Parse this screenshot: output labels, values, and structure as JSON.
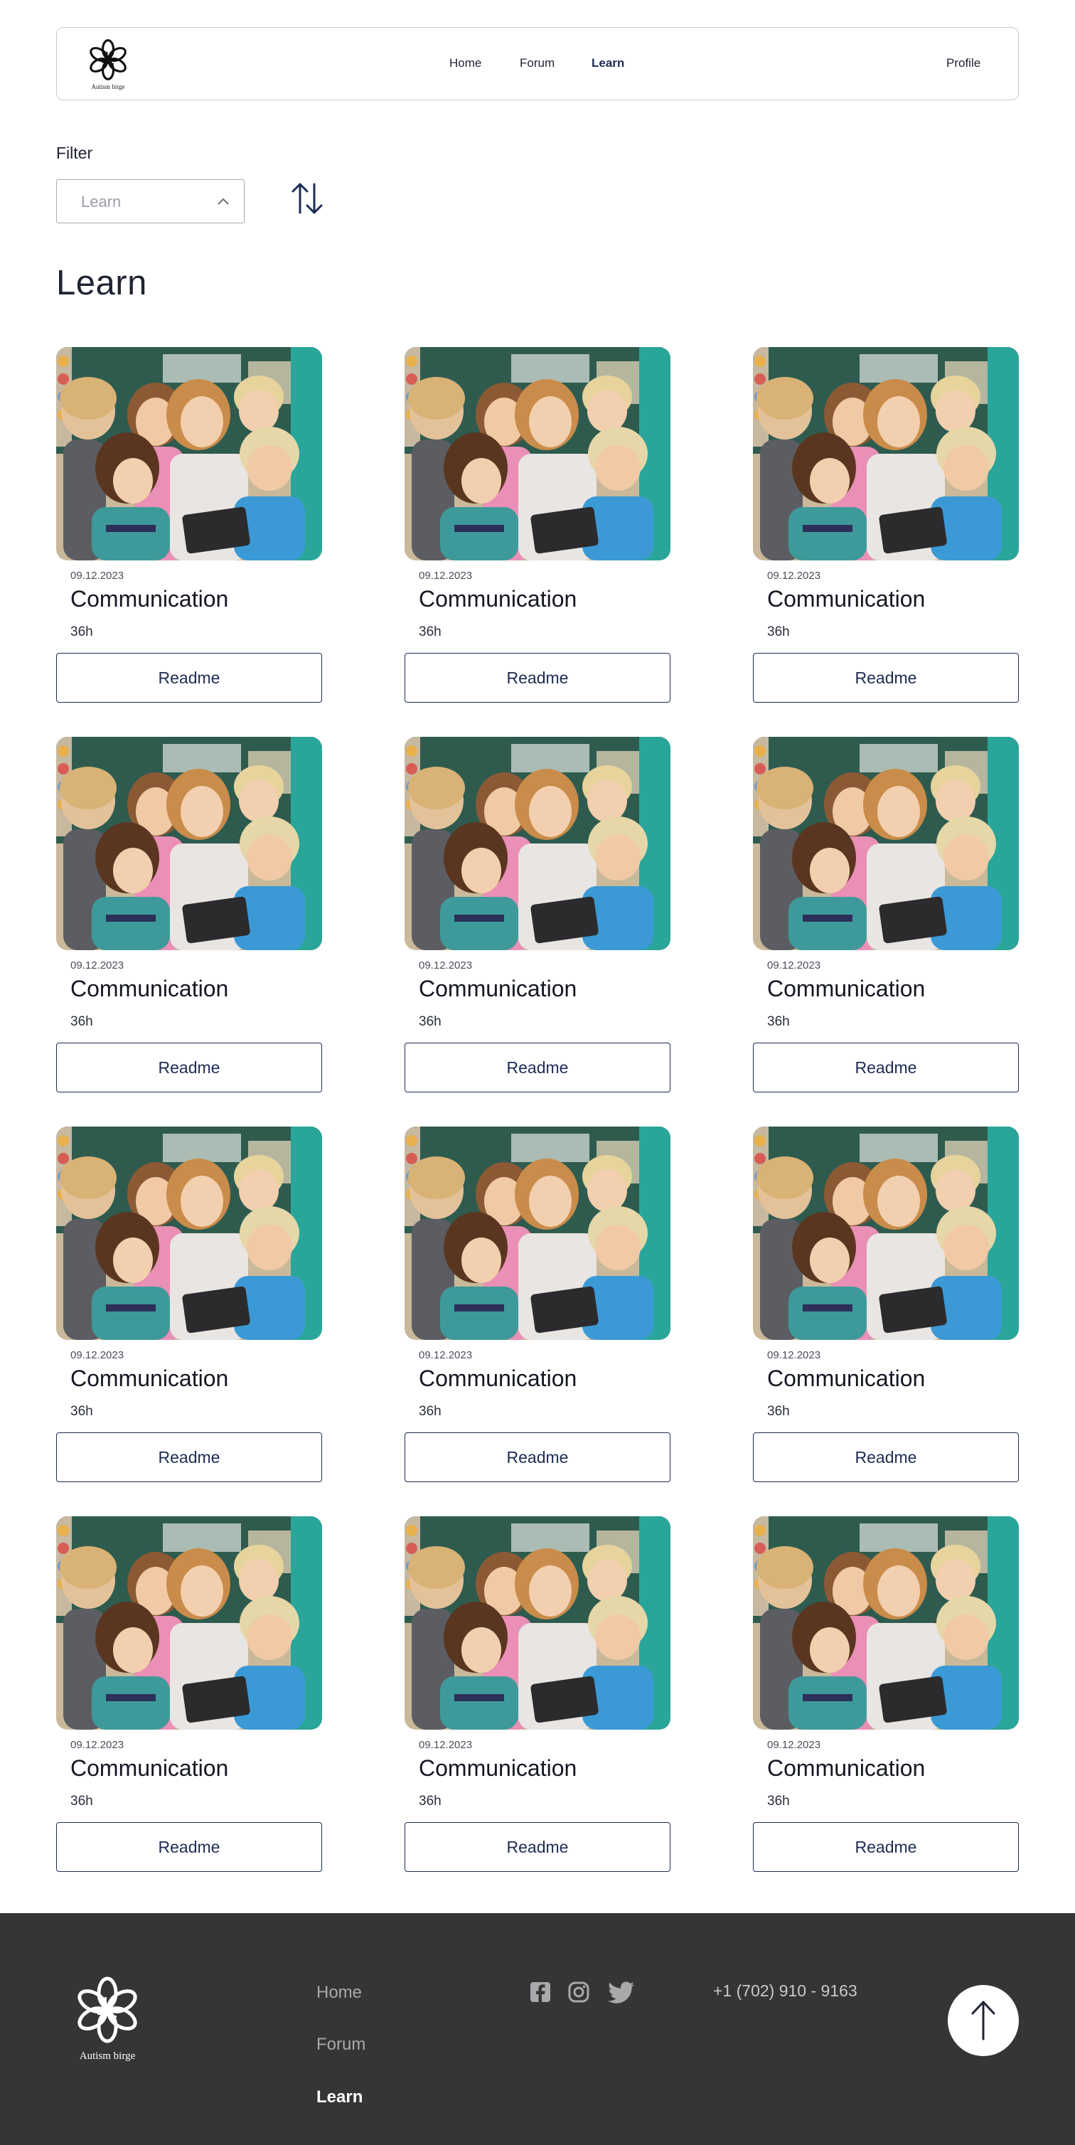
{
  "header": {
    "logo_text": "Autism birge",
    "nav": [
      {
        "label": "Home",
        "active": false
      },
      {
        "label": "Forum",
        "active": false
      },
      {
        "label": "Learn",
        "active": true
      }
    ],
    "profile_label": "Profile"
  },
  "filter": {
    "label": "Filter",
    "selected": "Learn"
  },
  "page_title": "Learn",
  "cards": [
    {
      "date": "09.12.2023",
      "title": "Communication",
      "duration": "36h",
      "button": "Readme"
    },
    {
      "date": "09.12.2023",
      "title": "Communication",
      "duration": "36h",
      "button": "Readme"
    },
    {
      "date": "09.12.2023",
      "title": "Communication",
      "duration": "36h",
      "button": "Readme"
    },
    {
      "date": "09.12.2023",
      "title": "Communication",
      "duration": "36h",
      "button": "Readme"
    },
    {
      "date": "09.12.2023",
      "title": "Communication",
      "duration": "36h",
      "button": "Readme"
    },
    {
      "date": "09.12.2023",
      "title": "Communication",
      "duration": "36h",
      "button": "Readme"
    },
    {
      "date": "09.12.2023",
      "title": "Communication",
      "duration": "36h",
      "button": "Readme"
    },
    {
      "date": "09.12.2023",
      "title": "Communication",
      "duration": "36h",
      "button": "Readme"
    },
    {
      "date": "09.12.2023",
      "title": "Communication",
      "duration": "36h",
      "button": "Readme"
    },
    {
      "date": "09.12.2023",
      "title": "Communication",
      "duration": "36h",
      "button": "Readme"
    },
    {
      "date": "09.12.2023",
      "title": "Communication",
      "duration": "36h",
      "button": "Readme"
    },
    {
      "date": "09.12.2023",
      "title": "Communication",
      "duration": "36h",
      "button": "Readme"
    }
  ],
  "footer": {
    "logo_text": "Autism birge",
    "nav": [
      {
        "label": "Home",
        "active": false
      },
      {
        "label": "Forum",
        "active": false
      },
      {
        "label": "Learn",
        "active": true
      }
    ],
    "social": [
      "facebook-icon",
      "instagram-icon",
      "twitter-icon"
    ],
    "phone": "+1 (702) 910 - 9163"
  },
  "colors": {
    "accent": "#1d2c53",
    "footer_bg": "#353436",
    "border": "#c9ccd4"
  }
}
